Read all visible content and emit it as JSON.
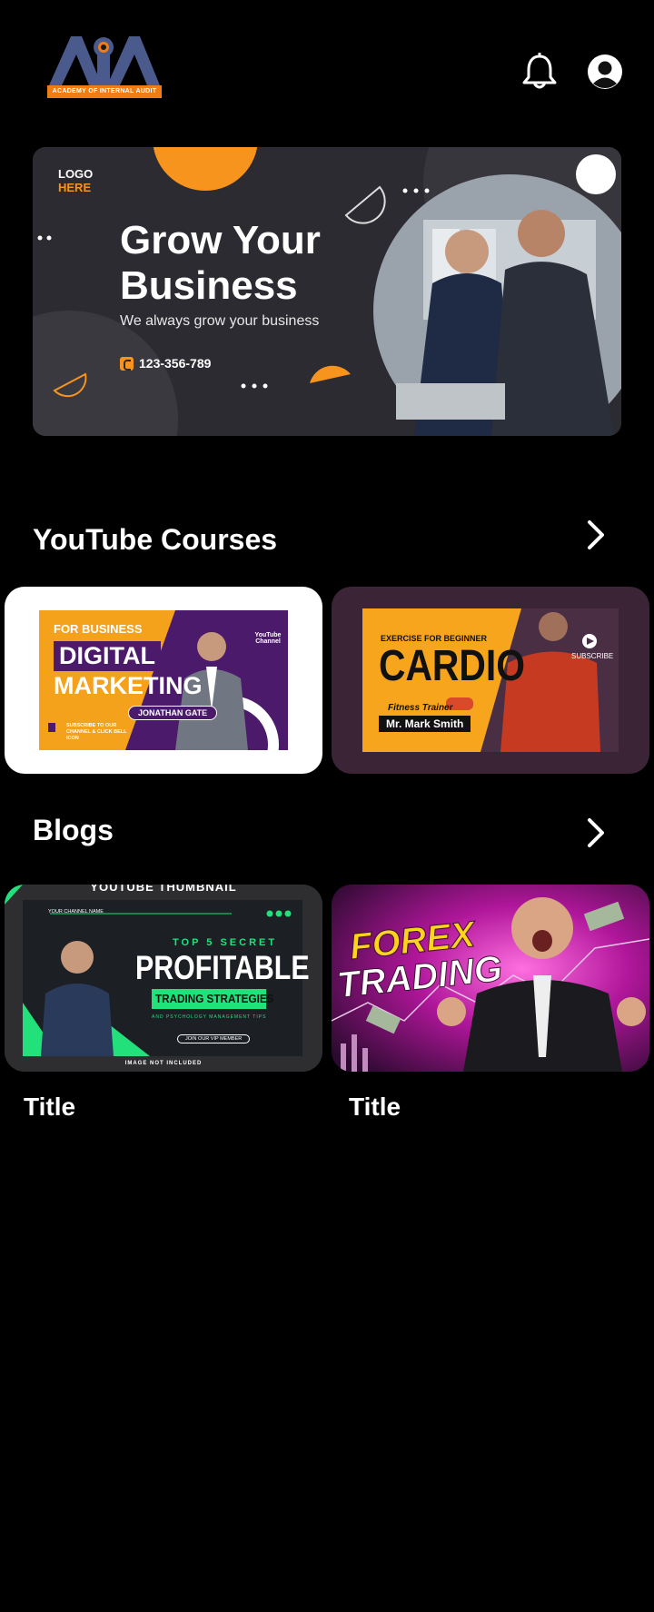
{
  "header": {
    "logo_letters": "AIA",
    "logo_tagline": "ACADEMY OF INTERNAL AUDIT",
    "notifications_icon": "bell-icon",
    "profile_icon": "user-avatar-icon"
  },
  "hero": {
    "logo_line1": "LOGO",
    "logo_line2": "HERE",
    "title_line1": "Grow Your",
    "title_line2": "Business",
    "subtitle": "We always grow your business",
    "phone": "123-356-789"
  },
  "courses": {
    "section_title": "YouTube Courses",
    "items": [
      {
        "tag": "FOR BUSINESS",
        "line1": "DIGITAL",
        "line2": "MARKETING",
        "name": "JONATHAN GATE",
        "channel": "YouTube Channel",
        "footer": "SUBSCRIBE TO OUR CHANNEL & CLICK BELL ICON"
      },
      {
        "tag": "EXERCISE FOR BEGINNER",
        "title": "CARDIO",
        "role": "Fitness Trainer",
        "name": "Mr. Mark Smith",
        "subscribe": "SUBSCRIBE"
      }
    ]
  },
  "blogs": {
    "section_title": "Blogs",
    "items": [
      {
        "banner": "YOUTUBE THUMBNAIL",
        "channel": "YOUR CHANNEL NAME",
        "kicker": "TOP 5 SECRET",
        "headline": "PROFITABLE",
        "highlight": "TRADING STRATEGIES",
        "tagline": "AND PSYCHOLOGY MANAGEMENT TIPS",
        "cta": "JOIN OUR VIP MEMBER",
        "footer": "IMAGE NOT INCLUDED",
        "title": "Title"
      },
      {
        "headline_line1": "FOREX",
        "headline_line2": "TRADING",
        "title": "Title"
      }
    ]
  },
  "colors": {
    "background": "#000000",
    "accent_orange": "#f7941d",
    "logo_blue": "#4a5a8c",
    "purple": "#4b1a6b",
    "green": "#22e07a"
  }
}
